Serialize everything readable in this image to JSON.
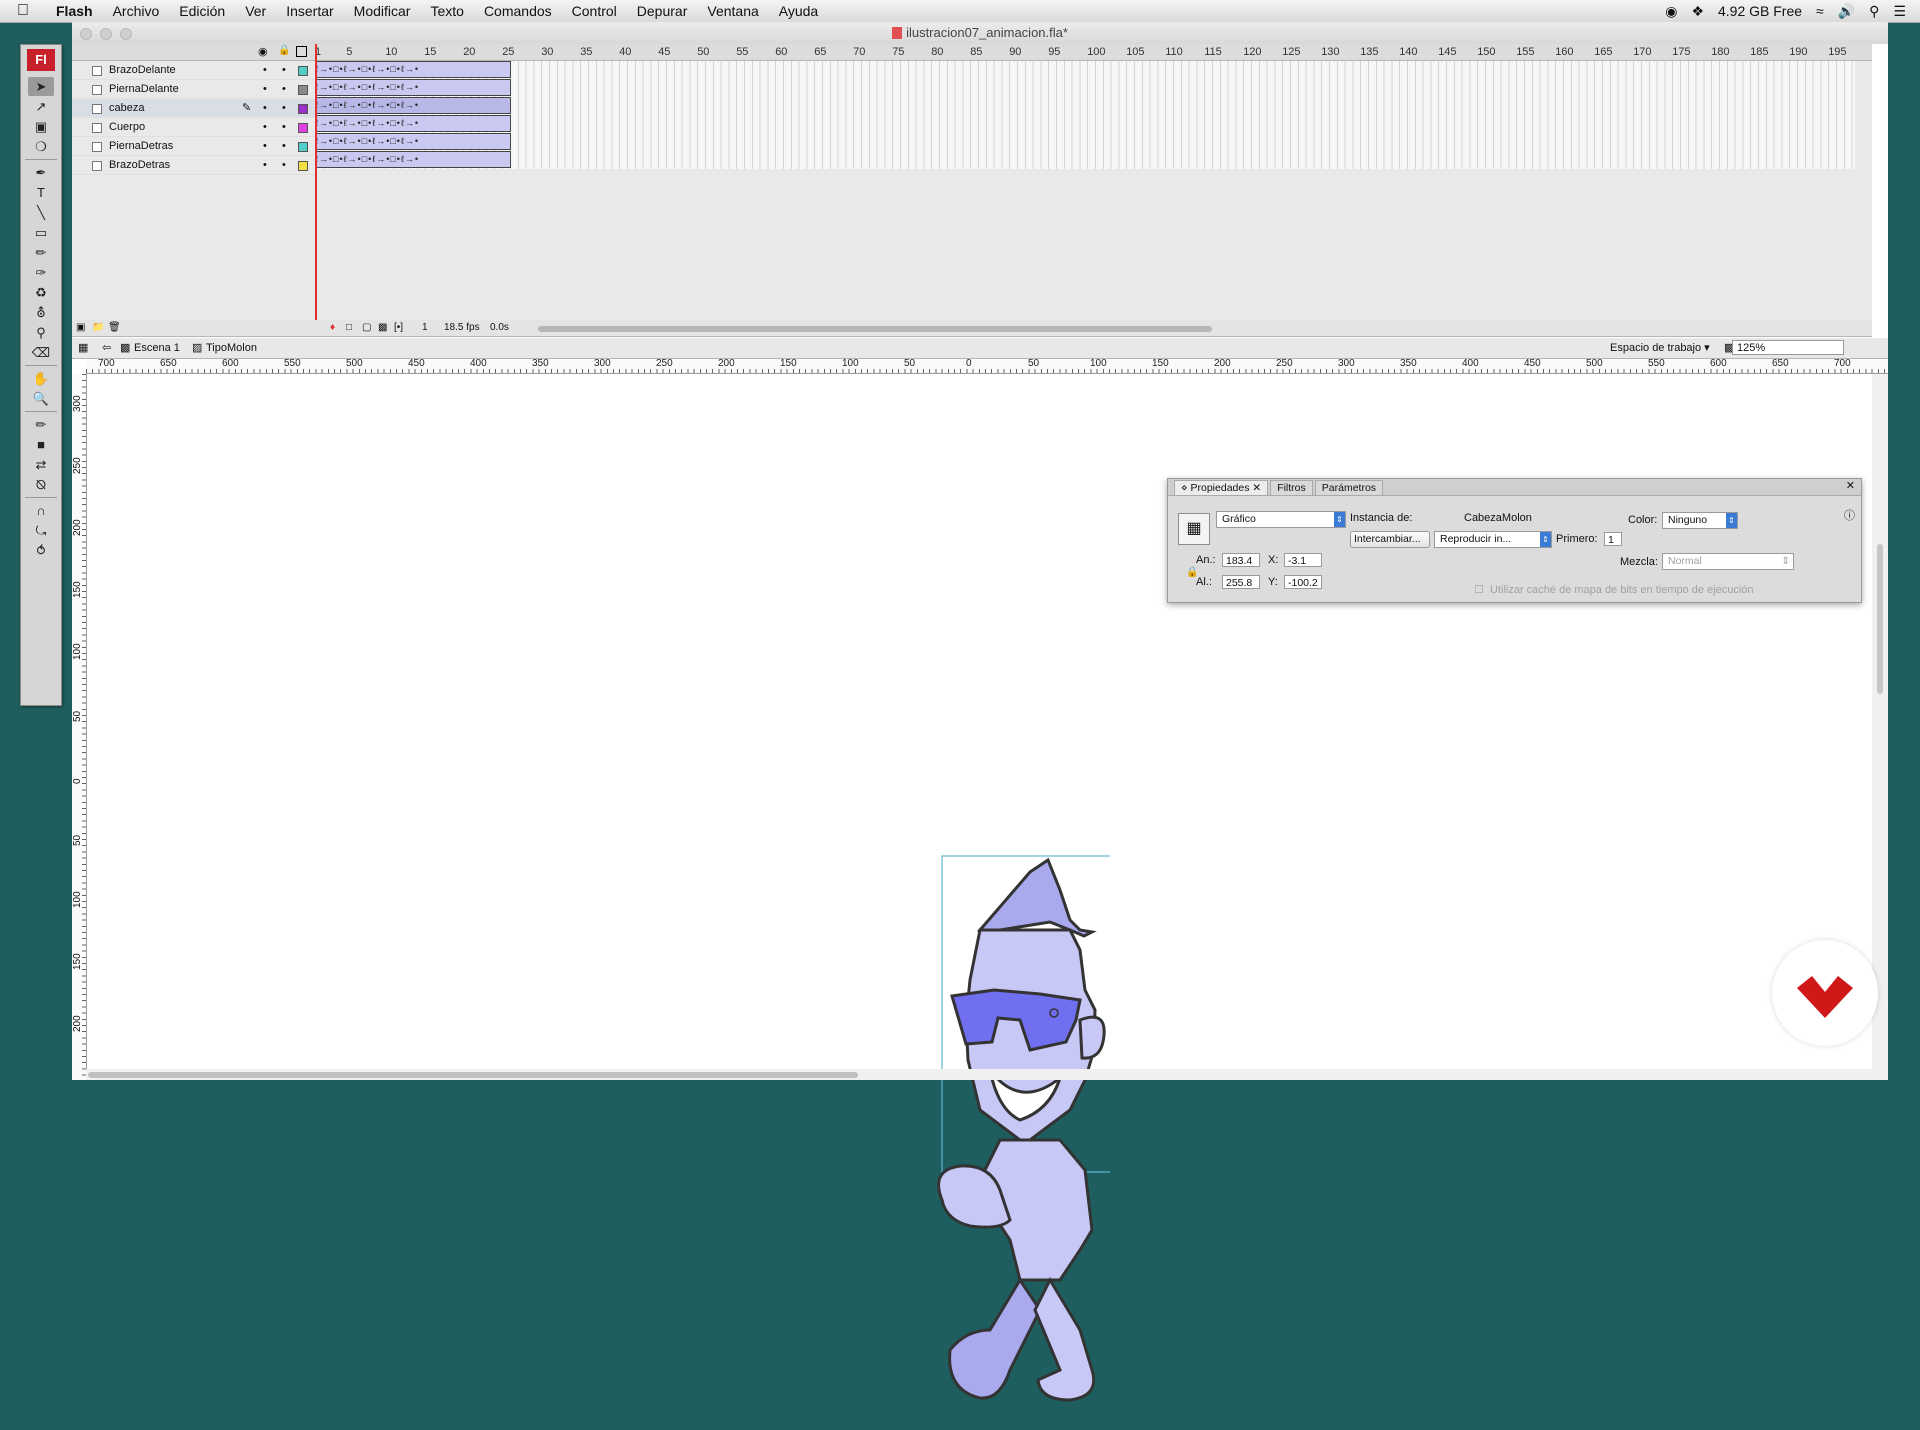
{
  "menubar": {
    "app": "Flash",
    "items": [
      "Archivo",
      "Edición",
      "Ver",
      "Insertar",
      "Modificar",
      "Texto",
      "Comandos",
      "Control",
      "Depurar",
      "Ventana",
      "Ayuda"
    ],
    "free_space": "4.92 GB Free"
  },
  "window": {
    "title": "ilustracion07_animacion.fla*"
  },
  "tools": {
    "logo": "Fl"
  },
  "timeline": {
    "frame_numbers": [
      "1",
      "5",
      "10",
      "15",
      "20",
      "25",
      "30",
      "35",
      "40",
      "45",
      "50",
      "55",
      "60",
      "65",
      "70",
      "75",
      "80",
      "85",
      "90",
      "95",
      "100",
      "105",
      "110",
      "115",
      "120",
      "125",
      "130",
      "135",
      "140",
      "145",
      "150",
      "155",
      "160",
      "165",
      "170",
      "175",
      "180",
      "185",
      "190",
      "195"
    ],
    "layers": [
      {
        "name": "BrazoDelante",
        "color": "#4ed0c8",
        "selected": false
      },
      {
        "name": "PiernaDelante",
        "color": "#8a8a8a",
        "selected": false
      },
      {
        "name": "cabeza",
        "color": "#9b30c8",
        "selected": true
      },
      {
        "name": "Cuerpo",
        "color": "#e040e0",
        "selected": false
      },
      {
        "name": "PiernaDetras",
        "color": "#4ed0c8",
        "selected": false
      },
      {
        "name": "BrazoDetras",
        "color": "#f0e040",
        "selected": false
      }
    ],
    "tween_glyphs": "ℓ→•□•ℓ→•□•ℓ→•□•ℓ→•",
    "current_frame": "1",
    "fps": "18.5 fps",
    "time": "0.0s"
  },
  "editbar": {
    "scene": "Escena 1",
    "symbol": "TipoMolon",
    "workspace": "Espacio de trabajo",
    "zoom": "125%"
  },
  "ruler": {
    "h_labels": [
      "700",
      "650",
      "600",
      "550",
      "500",
      "450",
      "400",
      "350",
      "300",
      "250",
      "200",
      "150",
      "100",
      "50",
      "0",
      "50",
      "100",
      "150",
      "200",
      "250",
      "300",
      "350",
      "400",
      "450",
      "500",
      "550",
      "600",
      "650",
      "700"
    ],
    "v_labels": [
      "300",
      "250",
      "200",
      "150",
      "100",
      "50",
      "0",
      "50",
      "100",
      "150",
      "200"
    ]
  },
  "properties": {
    "tabs": [
      "Propiedades",
      "Filtros",
      "Parámetros"
    ],
    "symbol_type": "Gráfico",
    "instance_label": "Instancia de:",
    "instance_name": "CabezaMolon",
    "swap_button": "Intercambiar...",
    "play_mode": "Reproducir in...",
    "first_label": "Primero:",
    "first_value": "1",
    "color_label": "Color:",
    "color_value": "Ninguno",
    "width_label": "An.:",
    "width_value": "183.4",
    "height_label": "Al.:",
    "height_value": "255.8",
    "x_label": "X:",
    "x_value": "-3.1",
    "y_label": "Y:",
    "y_value": "-100.2",
    "blend_label": "Mezcla:",
    "blend_value": "Normal",
    "cache_label": "Utilizar caché de mapa de bits en tiempo de ejecución"
  },
  "colors": {
    "character_fill": "#a9a9ee",
    "character_light": "#c8c8f6",
    "glasses": "#6f6ff0",
    "selection_box": "#62b6d8",
    "brand_logo": "#d01818"
  }
}
